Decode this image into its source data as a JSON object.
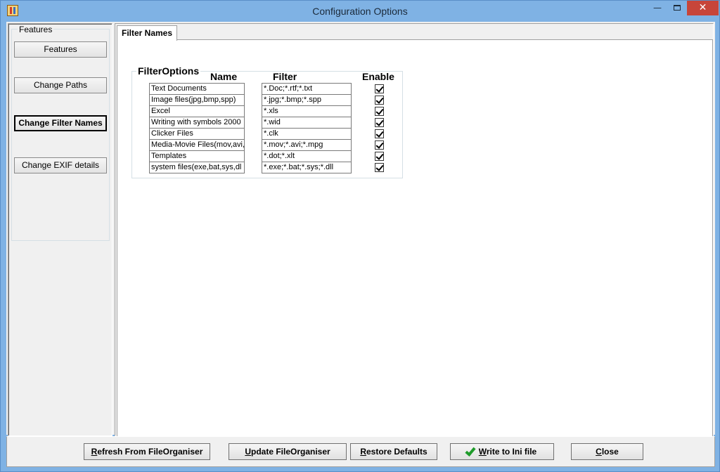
{
  "window": {
    "title": "Configuration Options",
    "minimize_glyph": "—",
    "close_glyph": "✕"
  },
  "features": {
    "group_label": "Features",
    "buttons": [
      {
        "label": "Features",
        "active": false
      },
      {
        "label": "Change Paths",
        "active": false
      },
      {
        "label": "Change Filter Names",
        "active": true
      },
      {
        "label": "Change EXIF details",
        "active": false
      }
    ]
  },
  "tab": {
    "label": "Filter Names"
  },
  "filter_options": {
    "group_label": "FilterOptions",
    "headers": {
      "name": "Name",
      "filter": "Filter",
      "enable": "Enable"
    },
    "rows": [
      {
        "name": "Text Documents",
        "filter": "*.Doc;*.rtf;*.txt",
        "enabled": true
      },
      {
        "name": "Image files(jpg,bmp,spp)",
        "filter": "*.jpg;*.bmp;*.spp",
        "enabled": true
      },
      {
        "name": "Excel",
        "filter": "*.xls",
        "enabled": true
      },
      {
        "name": "Writing with symbols 2000",
        "filter": "*.wid",
        "enabled": true
      },
      {
        "name": "Clicker Files",
        "filter": "*.clk",
        "enabled": true
      },
      {
        "name": "Media-Movie Files(mov,avi,r",
        "filter": "*.mov;*.avi;*.mpg",
        "enabled": true
      },
      {
        "name": "Templates",
        "filter": "*.dot;*.xlt",
        "enabled": true
      },
      {
        "name": "system files(exe,bat,sys,dl",
        "filter": "*.exe;*.bat;*.sys;*.dll",
        "enabled": true
      }
    ]
  },
  "bottom_buttons": {
    "refresh": {
      "first": "R",
      "rest": "efresh From FileOrganiser"
    },
    "update": {
      "first": "U",
      "rest": "pdate FileOrganiser"
    },
    "restore": {
      "first": "R",
      "rest": "estore Defaults"
    },
    "write": {
      "first": "W",
      "rest": "rite to Ini file"
    },
    "close": {
      "first": "C",
      "rest": "lose"
    }
  }
}
